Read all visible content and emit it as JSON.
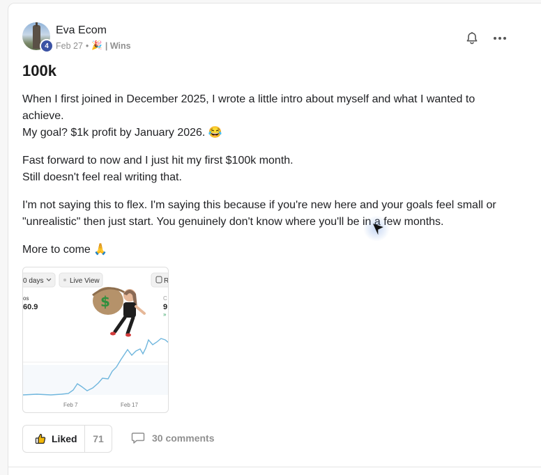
{
  "post": {
    "author": "Eva Ecom",
    "level": "4",
    "date": "Feb 27",
    "separator": "•",
    "category_emoji": "🎉",
    "category": "| Wins",
    "title": "100k",
    "paragraphs": [
      [
        "When I first joined in December 2025, I wrote a little intro about myself and what I wanted to achieve.",
        "My goal? $1k profit by January 2026. 😂"
      ],
      [
        "Fast forward to now and I just hit my first $100k month.",
        "Still doesn't feel real writing that."
      ],
      [
        "I'm not saying this to flex. I'm saying this because if you're new here and your goals feel small or \"unrealistic\" then just start. You genuinely don't know where you'll be in a few months."
      ],
      [
        "More to come 🙏"
      ]
    ]
  },
  "attachment": {
    "range_label": "0 days",
    "live_view_label": "Live View",
    "right_label": "R",
    "metric_label": "os",
    "metric_value": "60.9",
    "right_metric_label": "C",
    "right_metric_value": "9",
    "x_tick_1": "Feb 7",
    "x_tick_2": "Feb 17"
  },
  "actions": {
    "liked_label": "Liked",
    "like_count": "71",
    "comments_label": "30 comments"
  },
  "icons": [
    "bell-icon",
    "more-icon",
    "thumbs-up-icon",
    "comment-icon",
    "cursor-icon"
  ],
  "colors": {
    "badge": "#3b53a4",
    "chart_line": "#6fb6dd",
    "muted_text": "#909090"
  }
}
